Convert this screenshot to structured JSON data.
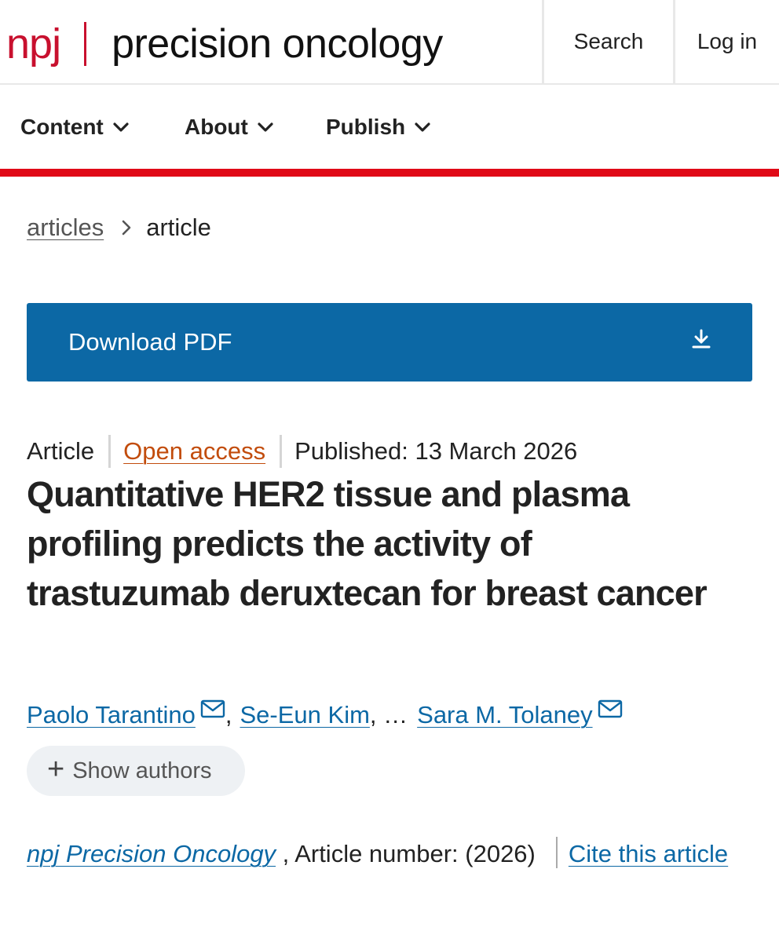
{
  "header": {
    "brand_short": "npj",
    "brand_name": "precision oncology",
    "search_label": "Search",
    "login_label": "Log in"
  },
  "nav": {
    "items": [
      {
        "label": "Content"
      },
      {
        "label": "About"
      },
      {
        "label": "Publish"
      }
    ]
  },
  "breadcrumb": {
    "parent": "articles",
    "current": "article"
  },
  "download": {
    "label": "Download PDF",
    "icon": "download-icon"
  },
  "article": {
    "type": "Article",
    "access": "Open access",
    "published": "Published: 13 March 2026",
    "title": "Quantitative HER2 tissue and plasma profiling predicts the activity of trastuzumab deruxtecan for breast cancer",
    "authors": [
      {
        "name": "Paolo Tarantino",
        "has_email": true
      },
      {
        "name": "Se-Eun Kim",
        "has_email": false
      },
      {
        "name": "Sara M. Tolaney",
        "has_email": true
      }
    ],
    "authors_sep": ",",
    "authors_ellipsis": ", …",
    "show_authors_label": "Show authors"
  },
  "citation": {
    "journal": "npj Precision Oncology",
    "article_number_text": " , Article number:  (2026)",
    "cite_label": "Cite this article"
  },
  "colors": {
    "brand_red": "#c8102e",
    "link_blue": "#0c68a5",
    "open_access_orange": "#c24c0c",
    "nav_rule_red": "#e00a17"
  }
}
